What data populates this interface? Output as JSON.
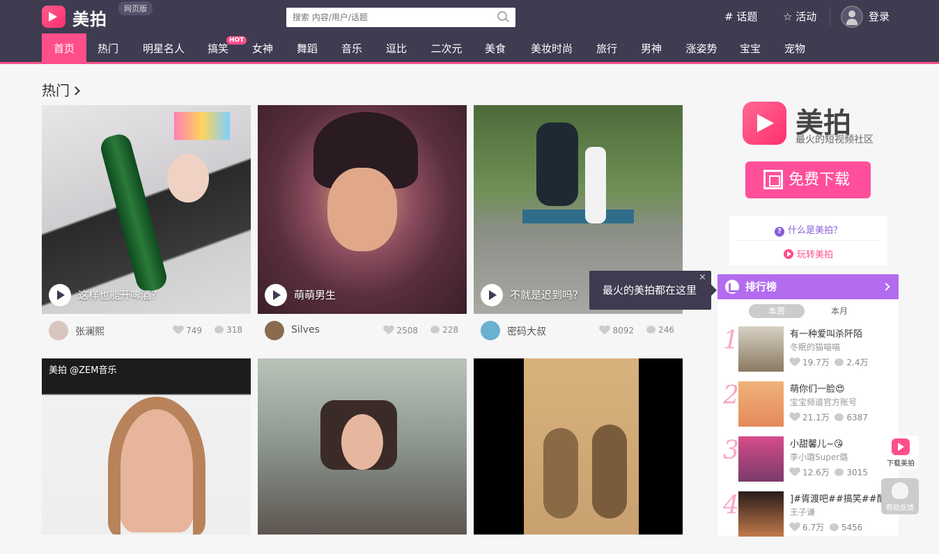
{
  "header": {
    "brand": "美拍",
    "web_badge": "网页版",
    "search_placeholder": "搜索 内容/用户/话题",
    "topic_link": "# 话题",
    "activity_link": "☆ 活动",
    "login_link": "登录"
  },
  "nav": {
    "items": [
      "首页",
      "热门",
      "明星名人",
      "搞笑",
      "女神",
      "舞蹈",
      "音乐",
      "逗比",
      "二次元",
      "美食",
      "美妆时尚",
      "旅行",
      "男神",
      "涨姿势",
      "宝宝",
      "宠物"
    ],
    "active": "首页",
    "hot_badge": "HOT"
  },
  "section": {
    "title": "热门"
  },
  "videos": [
    {
      "caption": "这样也能开啤酒？",
      "user": "张澜熙",
      "likes": "749",
      "comments": "318"
    },
    {
      "caption": "萌萌男生",
      "user": "Silves",
      "likes": "2508",
      "comments": "228"
    },
    {
      "caption": "不就是迟到吗？",
      "user": "密码大叔",
      "likes": "8092",
      "comments": "246"
    }
  ],
  "watermark_text": "美拍 @ZEM音乐",
  "tooltip": {
    "text": "最火的美拍都在这里",
    "close": "×"
  },
  "sidebar": {
    "brand": "美拍",
    "slogan": "最火的短视频社区",
    "download_label": "免费下载",
    "what_is": "什么是美拍？",
    "play_with": "玩转美拍"
  },
  "ranking": {
    "title": "排行榜",
    "tabs": [
      "本周",
      "本月"
    ],
    "active_tab": "本周",
    "items": [
      {
        "rank": "1",
        "title": "有一种爱叫杀阡陌",
        "user": "冬眠的猫喵喵",
        "likes": "19.7万",
        "comments": "2.4万"
      },
      {
        "rank": "2",
        "title": "萌你们一脸😍",
        "user": "宝宝频道官方账号",
        "likes": "21.1万",
        "comments": "6387"
      },
      {
        "rank": "3",
        "title": "小甜馨儿~😘",
        "user": "李小璐Super璐",
        "likes": "12.6万",
        "comments": "3015"
      },
      {
        "rank": "4",
        "title": "]#胥渡吧##搞笑##配...",
        "user": "王子谦",
        "likes": "6.7万",
        "comments": "5456"
      }
    ]
  },
  "float": {
    "download": "下载美拍",
    "help": "帮助反馈"
  },
  "colors": {
    "nav_bg": "#3f3b51",
    "accent_pink": "#ff4f8b",
    "rank_purple": "#b36cf0"
  }
}
